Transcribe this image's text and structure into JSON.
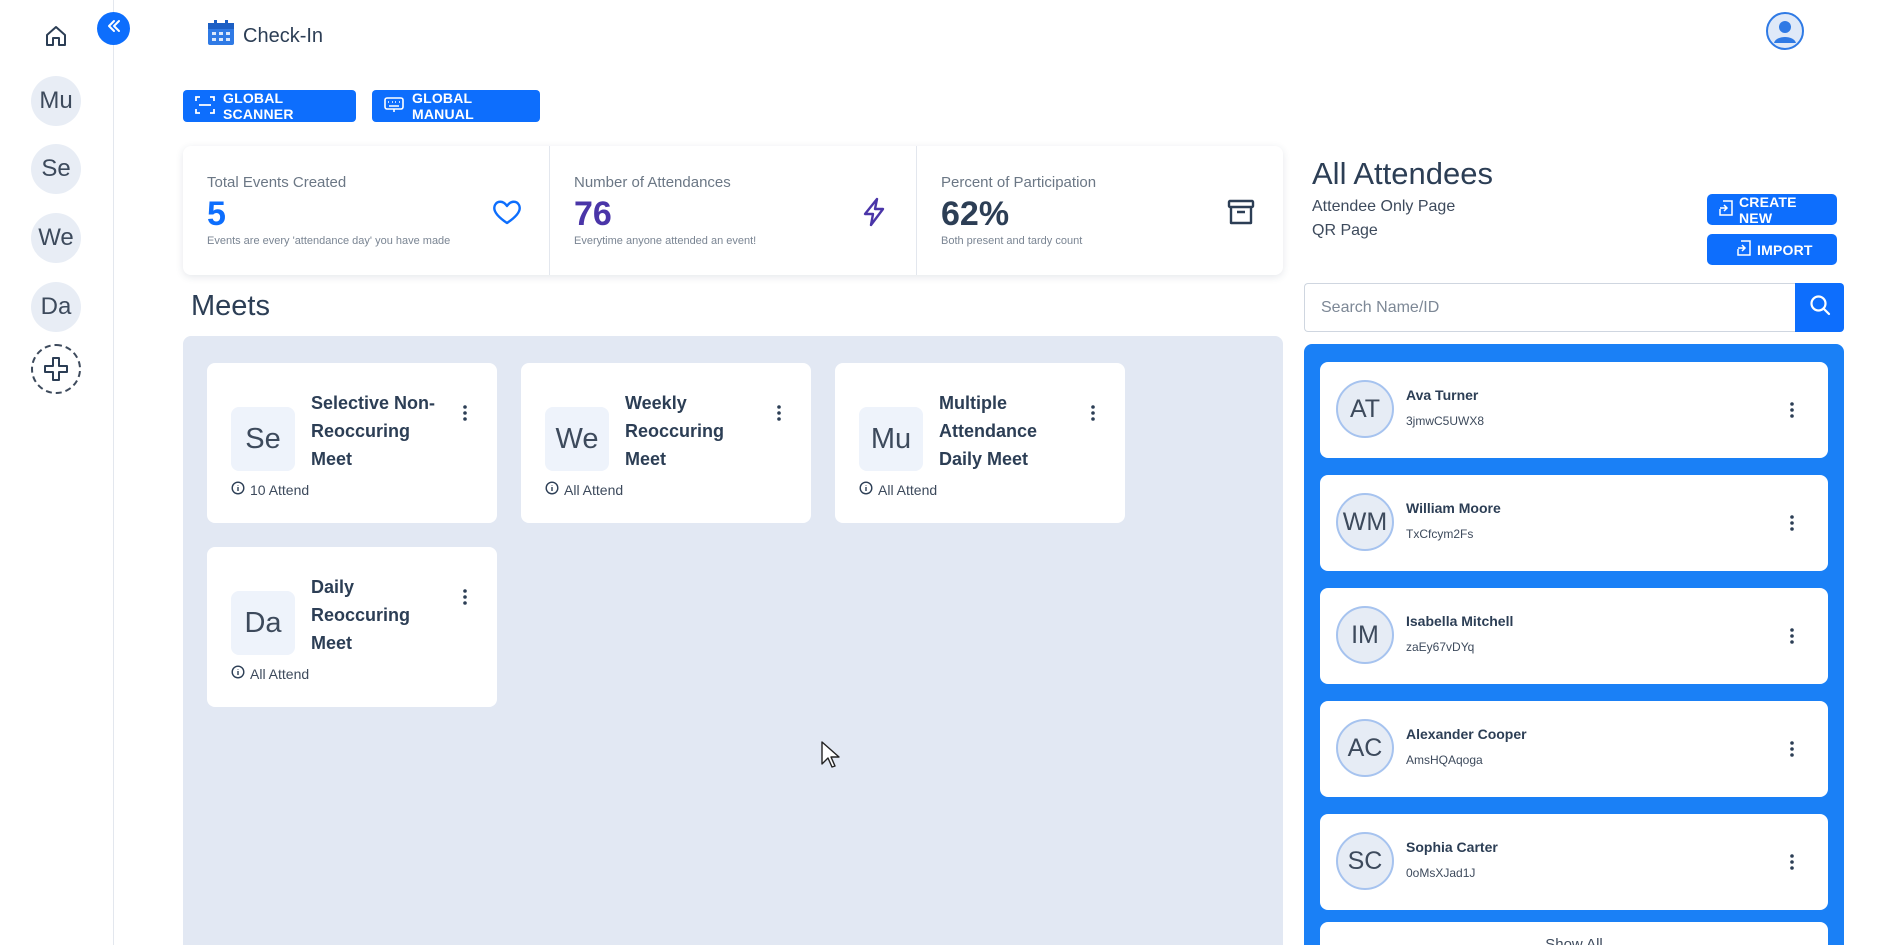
{
  "rail": {
    "bubbles": [
      "Mu",
      "Se",
      "We",
      "Da"
    ]
  },
  "header": {
    "title": "Check-In"
  },
  "actions": {
    "global_scanner": "GLOBAL SCANNER",
    "global_manual": "GLOBAL MANUAL"
  },
  "stats": [
    {
      "label": "Total Events Created",
      "value": "5",
      "sub": "Events are every 'attendance day' you have made",
      "color": "#0d6efd",
      "icon": "heart-icon"
    },
    {
      "label": "Number of Attendances",
      "value": "76",
      "sub": "Everytime anyone attended an event!",
      "color": "#4a35a8",
      "icon": "lightning-icon"
    },
    {
      "label": "Percent of Participation",
      "value": "62%",
      "sub": "Both present and tardy count",
      "color": "#2c3e55",
      "icon": "archive-icon"
    }
  ],
  "meets": {
    "title": "Meets",
    "cards": [
      {
        "initials": "Se",
        "name": "Selective Non-Reoccuring Meet",
        "attend": "10 Attend"
      },
      {
        "initials": "We",
        "name": "Weekly Reoccuring Meet",
        "attend": "All Attend"
      },
      {
        "initials": "Mu",
        "name": "Multiple Attendance Daily Meet",
        "attend": "All Attend"
      },
      {
        "initials": "Da",
        "name": "Daily Reoccuring Meet",
        "attend": "All Attend"
      }
    ]
  },
  "attendees": {
    "title": "All Attendees",
    "link_attendee_only": "Attendee Only Page",
    "link_qr": "QR Page",
    "create_new": "CREATE NEW",
    "import": "IMPORT",
    "search_placeholder": "Search Name/ID",
    "show_all": "Show All",
    "list": [
      {
        "initials": "AT",
        "name": "Ava Turner",
        "id": "3jmwC5UWX8"
      },
      {
        "initials": "WM",
        "name": "William Moore",
        "id": "TxCfcym2Fs"
      },
      {
        "initials": "IM",
        "name": "Isabella Mitchell",
        "id": "zaEy67vDYq"
      },
      {
        "initials": "AC",
        "name": "Alexander Cooper",
        "id": "AmsHQAqoga"
      },
      {
        "initials": "SC",
        "name": "Sophia Carter",
        "id": "0oMsXJad1J"
      }
    ]
  },
  "colors": {
    "accent": "#0d6efd",
    "panel_blue": "#1a80f6",
    "meets_bg": "#e2e8f3"
  }
}
